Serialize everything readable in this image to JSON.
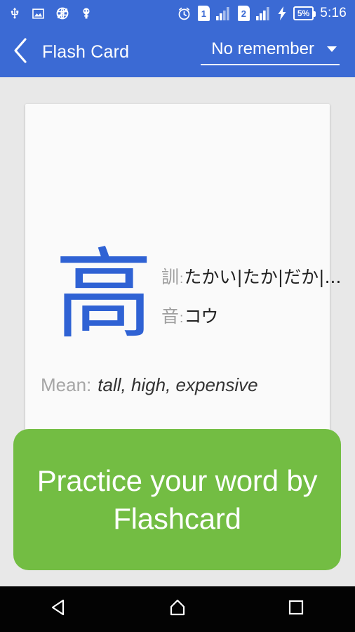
{
  "status_bar": {
    "icons": [
      "usb-icon",
      "screenshot-icon",
      "no-network-icon",
      "developer-icon"
    ],
    "alarm_icon": "alarm-icon",
    "sim1_label": "1",
    "sim2_label": "2",
    "sim1_signal_icon": "signal-bars-icon",
    "sim2_signal_icon": "signal-bars-icon",
    "charging_icon": "charging-bolt-icon",
    "battery_percent": "5%",
    "time": "5:16"
  },
  "app_bar": {
    "back_icon": "back-chevron-icon",
    "title": "Flash Card",
    "spinner_value": "No remember",
    "spinner_caret_icon": "chevron-down-icon"
  },
  "card": {
    "kanji": "高",
    "kun_label": "訓",
    "kun_separator": ":",
    "kun_value": "たかい|たか|だか|...",
    "on_label": "音",
    "on_separator": ":",
    "on_value": "コウ",
    "mean_label": "Mean:",
    "mean_value": "tall, high, expensive"
  },
  "coach_mark": {
    "text": "Practice your word by Flashcard"
  },
  "nav_bar": {
    "back_icon": "nav-back-triangle-icon",
    "home_icon": "nav-home-icon",
    "recents_icon": "nav-recents-square-icon"
  },
  "colors": {
    "primary_blue": "#3b6ad4",
    "kanji_blue": "#2f62d4",
    "coach_green": "#73bd43",
    "page_background": "#e8e8e8",
    "card_background": "#fafafa"
  }
}
